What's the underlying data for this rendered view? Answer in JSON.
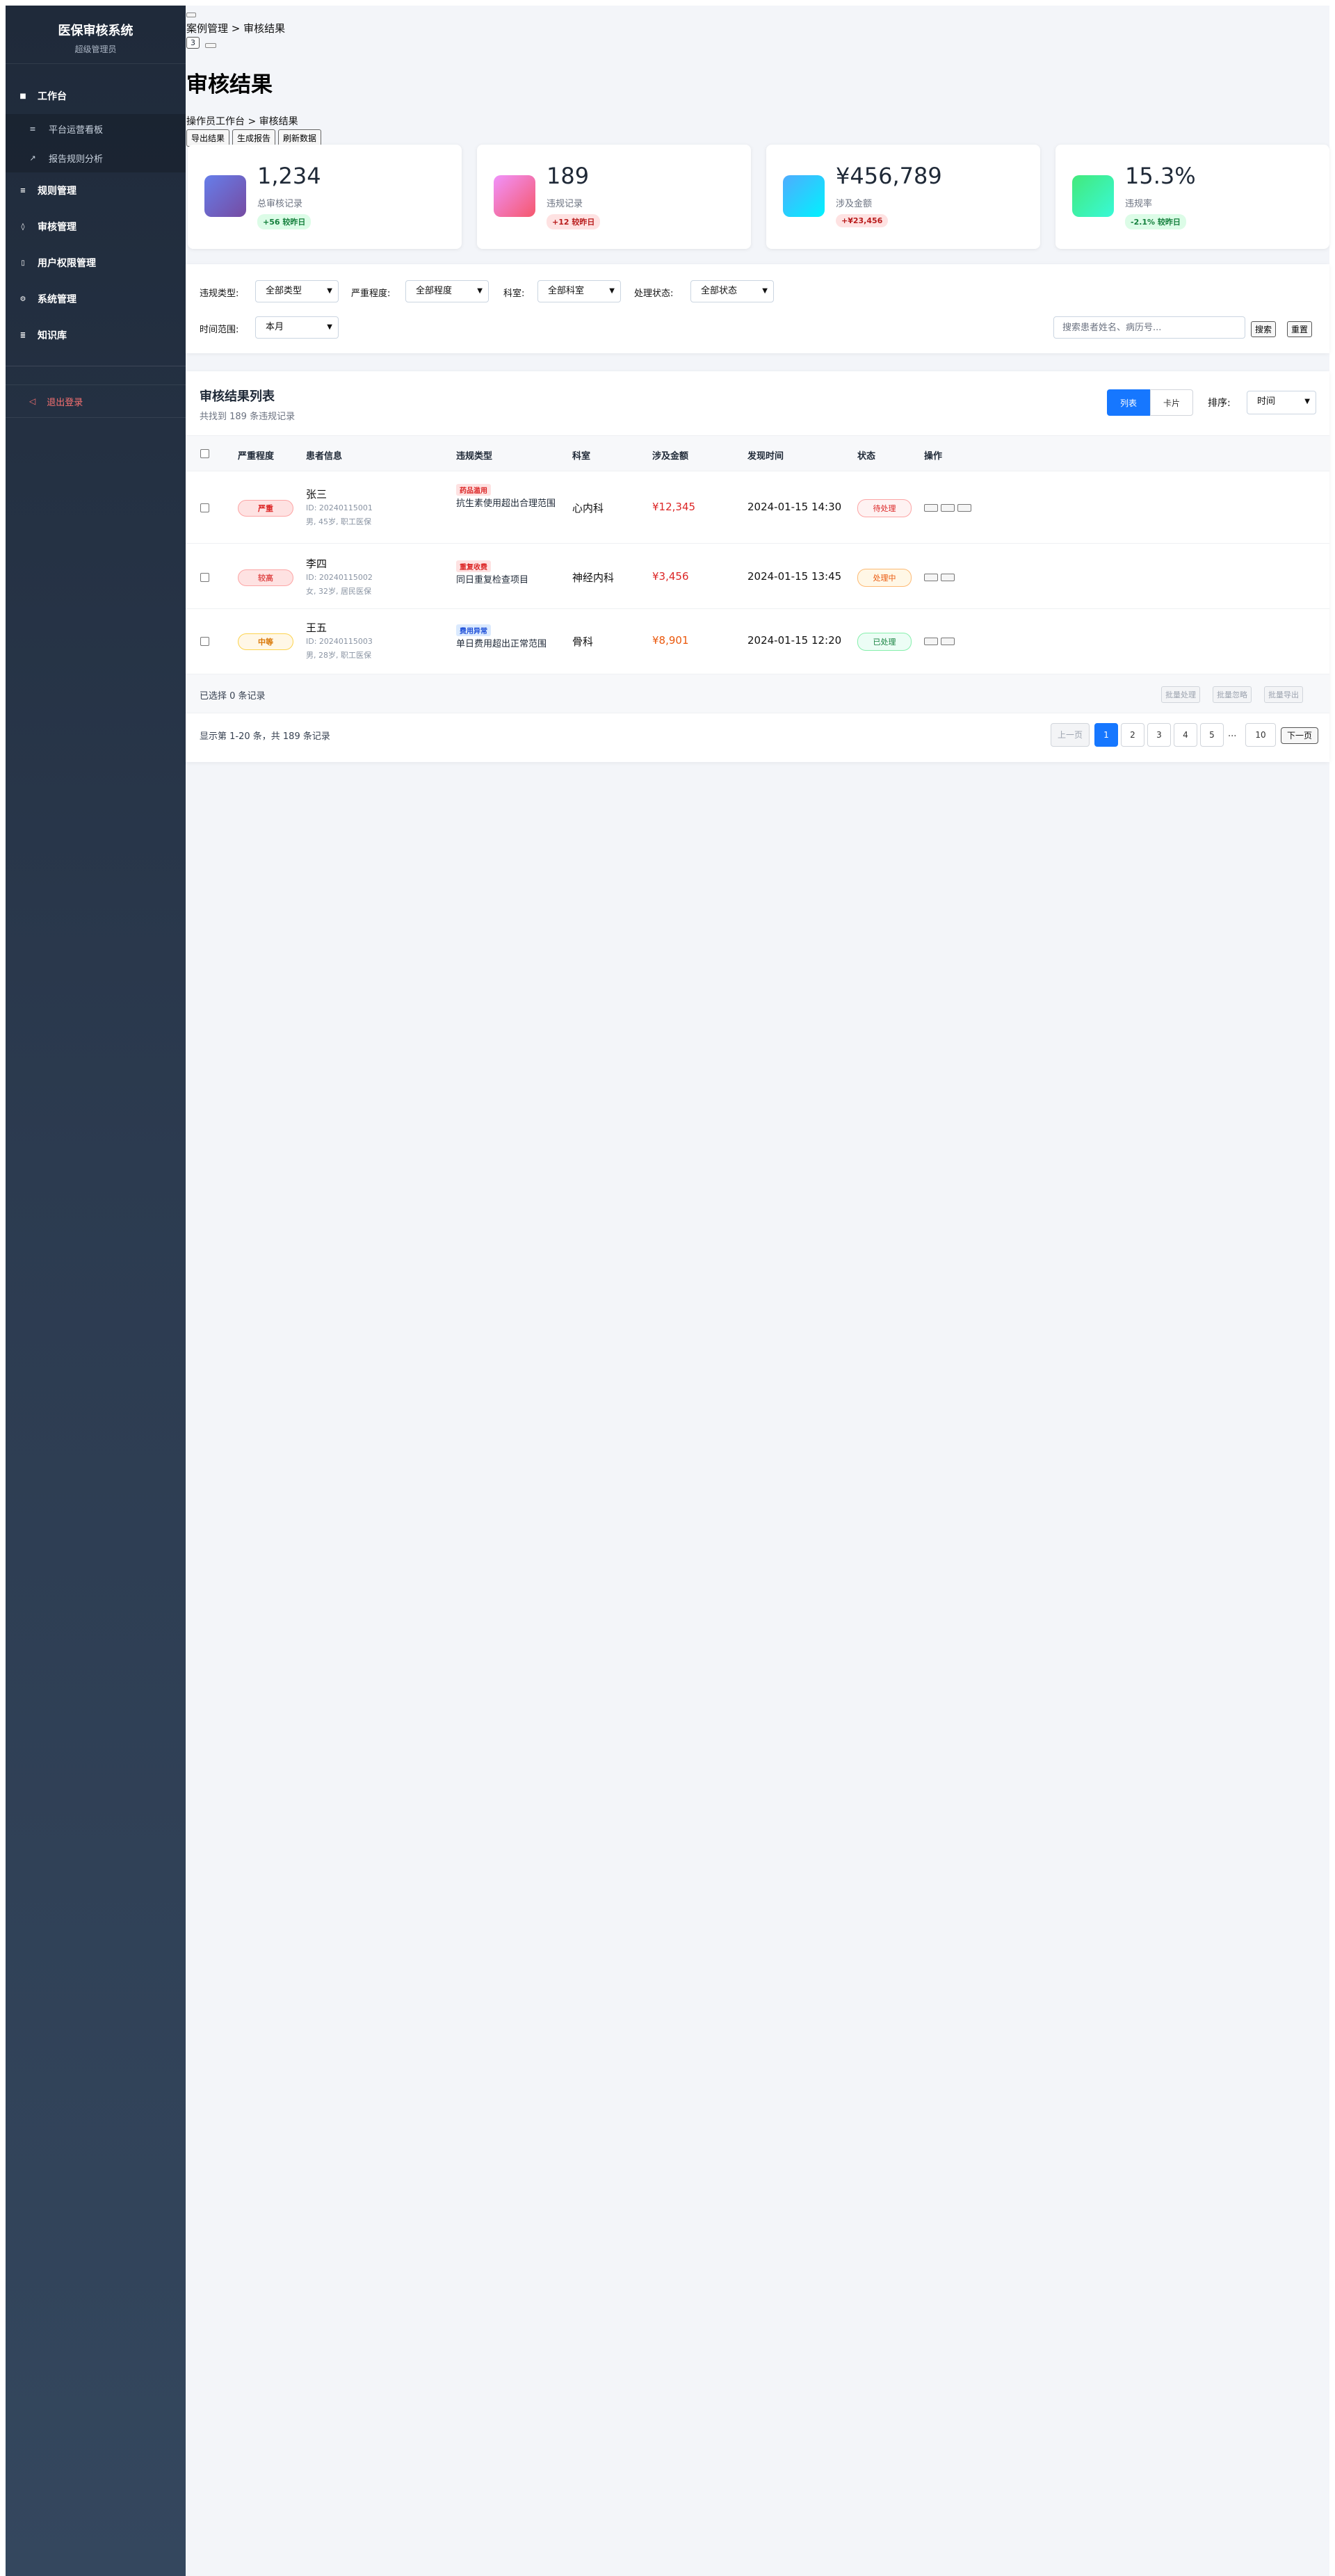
{
  "brand": {
    "title": "医保审核系统",
    "subtitle": "超级管理员"
  },
  "sidebar": {
    "groups": [
      {
        "label": "工作台",
        "icon": "■"
      },
      {
        "label": "规则管理",
        "icon": "≡"
      },
      {
        "label": "审核管理",
        "icon": "◊"
      },
      {
        "label": "用户权限管理",
        "icon": "▯"
      },
      {
        "label": "系统管理",
        "icon": "⚙"
      },
      {
        "label": "知识库",
        "icon": "≣"
      }
    ],
    "subitems": [
      {
        "label": "平台运营看板",
        "icon": "≡"
      },
      {
        "label": "报告规则分析",
        "icon": "↗"
      }
    ],
    "logout": {
      "label": "退出登录",
      "icon": "◁"
    }
  },
  "header": {
    "breadcrumb_top": "案例管理 > 审核结果",
    "count_badge": "3",
    "title": "审核结果",
    "breadcrumb": "操作员工作台 > 审核结果",
    "actions": [
      "导出结果",
      "生成报告",
      "刷新数据"
    ]
  },
  "stats": [
    {
      "value": "1,234",
      "label": "总审核记录",
      "delta": "+56 较昨日",
      "color_from": "#667eea",
      "color_to": "#764ba2"
    },
    {
      "value": "189",
      "label": "违规记录",
      "delta": "+12 较昨日",
      "color_from": "#f093fb",
      "color_to": "#f5576c"
    },
    {
      "value": "¥456,789",
      "label": "涉及金额",
      "delta": "+¥23,456",
      "color_from": "#4facfe",
      "color_to": "#00f2fe"
    },
    {
      "value": "15.3%",
      "label": "违规率",
      "delta": "-2.1% 较昨日",
      "color_from": "#43e97b",
      "color_to": "#38f9d7"
    }
  ],
  "filters": {
    "violation_type_label": "违规类型:",
    "violation_type_value": "全部类型",
    "severity_label": "严重程度:",
    "severity_value": "全部程度",
    "dept_label": "科室:",
    "dept_value": "全部科室",
    "status_label": "处理状态:",
    "status_value": "全部状态",
    "time_label": "时间范围:",
    "time_value": "本月",
    "search_placeholder": "搜索患者姓名、病历号...",
    "search_btn": "搜索",
    "reset_btn": "重置"
  },
  "results": {
    "title": "审核结果列表",
    "subtitle": "共找到 189 条违规记录",
    "view_list": "列表",
    "view_card": "卡片",
    "sort_label": "排序:",
    "sort_value": "时间",
    "columns": [
      "严重程度",
      "患者信息",
      "违规类型",
      "科室",
      "涉及金额",
      "发现时间",
      "状态",
      "操作"
    ],
    "rows": [
      {
        "severity": "严重",
        "name": "张三",
        "id": "ID: 20240115001",
        "meta": "男, 45岁, 职工医保",
        "tag": "药品滥用",
        "desc": "抗生素使用超出合理范围",
        "dept": "心内科",
        "amount": "¥12,345",
        "time": "2024-01-15 14:30",
        "status": "待处理"
      },
      {
        "severity": "较高",
        "name": "李四",
        "id": "ID: 20240115002",
        "meta": "女, 32岁, 居民医保",
        "tag": "重复收费",
        "desc": "同日重复检查项目",
        "dept": "神经内科",
        "amount": "¥3,456",
        "time": "2024-01-15 13:45",
        "status": "处理中"
      },
      {
        "severity": "中等",
        "name": "王五",
        "id": "ID: 20240115003",
        "meta": "男, 28岁, 职工医保",
        "tag": "费用异常",
        "desc": "单日费用超出正常范围",
        "dept": "骨科",
        "amount": "¥8,901",
        "time": "2024-01-15 12:20",
        "status": "已处理"
      }
    ],
    "selected_text": "已选择 0 条记录",
    "batch": [
      "批量处理",
      "批量忽略",
      "批量导出"
    ],
    "pager_info": "显示第 1-20 条，共 189 条记录",
    "pager": {
      "prev": "上一页",
      "pages": [
        "1",
        "2",
        "3",
        "4",
        "5"
      ],
      "ellipsis": "...",
      "last": "10",
      "next": "下一页"
    }
  }
}
